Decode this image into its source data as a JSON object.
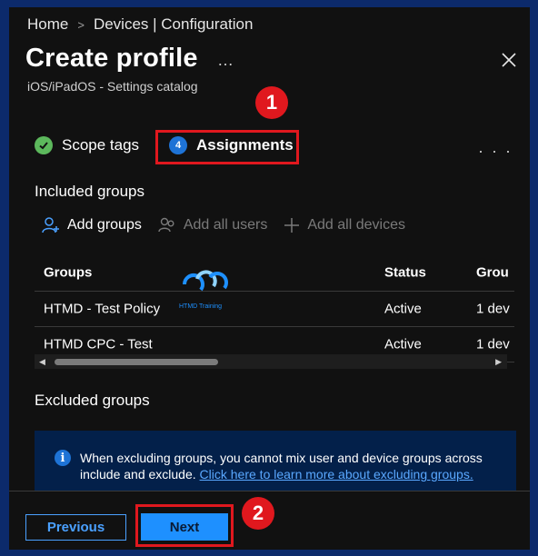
{
  "breadcrumb": {
    "home": "Home",
    "separator": ">",
    "current": "Devices | Configuration"
  },
  "header": {
    "title": "Create profile",
    "more": "…",
    "subtitle": "iOS/iPadOS - Settings catalog"
  },
  "callouts": {
    "one": "1",
    "two": "2"
  },
  "steps": [
    {
      "label": "Scope tags",
      "state": "complete"
    },
    {
      "number": "4",
      "label": "Assignments",
      "state": "current"
    }
  ],
  "steps_more": "· · ·",
  "included": {
    "heading": "Included groups",
    "commands": {
      "add_groups": "Add groups",
      "add_all_users": "Add all users",
      "add_all_devices": "Add all devices"
    },
    "columns": [
      "Groups",
      "Status",
      "Grou"
    ],
    "rows": [
      {
        "group": "HTMD - Test Policy",
        "status": "Active",
        "count": "1 dev"
      },
      {
        "group": "HTMD CPC - Test",
        "status": "Active",
        "count": "1 dev"
      }
    ]
  },
  "watermark": {
    "text": "HTMD Training"
  },
  "excluded": {
    "heading": "Excluded groups",
    "info_text": "When excluding groups, you cannot mix user and device groups across include and exclude. ",
    "info_link": "Click here to learn more about excluding groups."
  },
  "footer": {
    "previous": "Previous",
    "next": "Next"
  },
  "colors": {
    "accent": "#1e90ff",
    "callout": "#e0181e",
    "background": "#111111",
    "frame": "#0c2a6b"
  }
}
